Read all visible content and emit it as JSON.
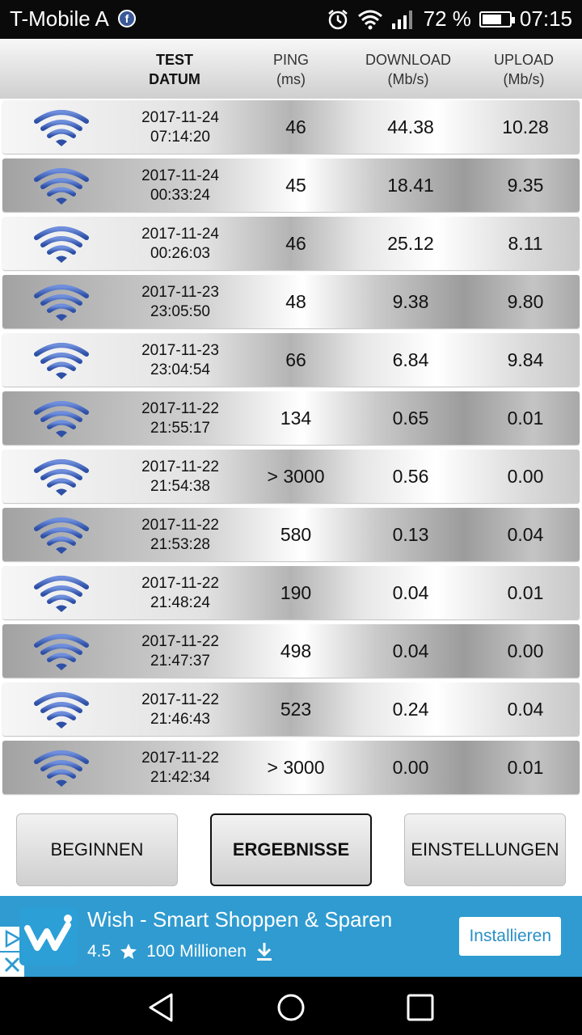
{
  "status_bar": {
    "carrier": "T-Mobile A",
    "battery_text": "72 %",
    "time": "07:15",
    "battery_level": 0.72
  },
  "header": {
    "col_test": "TEST",
    "col_datum": "DATUM",
    "col_ping": "PING",
    "col_ping_unit": "(ms)",
    "col_download": "DOWNLOAD",
    "col_download_unit": "(Mb/s)",
    "col_upload": "UPLOAD",
    "col_upload_unit": "(Mb/s)"
  },
  "rows": [
    {
      "date": "2017-11-24",
      "time": "07:14:20",
      "ping": "46",
      "download": "44.38",
      "upload": "10.28"
    },
    {
      "date": "2017-11-24",
      "time": "00:33:24",
      "ping": "45",
      "download": "18.41",
      "upload": "9.35"
    },
    {
      "date": "2017-11-24",
      "time": "00:26:03",
      "ping": "46",
      "download": "25.12",
      "upload": "8.11"
    },
    {
      "date": "2017-11-23",
      "time": "23:05:50",
      "ping": "48",
      "download": "9.38",
      "upload": "9.80"
    },
    {
      "date": "2017-11-23",
      "time": "23:04:54",
      "ping": "66",
      "download": "6.84",
      "upload": "9.84"
    },
    {
      "date": "2017-11-22",
      "time": "21:55:17",
      "ping": "134",
      "download": "0.65",
      "upload": "0.01"
    },
    {
      "date": "2017-11-22",
      "time": "21:54:38",
      "ping": "> 3000",
      "download": "0.56",
      "upload": "0.00"
    },
    {
      "date": "2017-11-22",
      "time": "21:53:28",
      "ping": "580",
      "download": "0.13",
      "upload": "0.04"
    },
    {
      "date": "2017-11-22",
      "time": "21:48:24",
      "ping": "190",
      "download": "0.04",
      "upload": "0.01"
    },
    {
      "date": "2017-11-22",
      "time": "21:47:37",
      "ping": "498",
      "download": "0.04",
      "upload": "0.00"
    },
    {
      "date": "2017-11-22",
      "time": "21:46:43",
      "ping": "523",
      "download": "0.24",
      "upload": "0.04"
    },
    {
      "date": "2017-11-22",
      "time": "21:42:34",
      "ping": "> 3000",
      "download": "0.00",
      "upload": "0.01"
    }
  ],
  "buttons": {
    "start": "BEGINNEN",
    "results": "ERGEBNISSE",
    "settings": "EINSTELLUNGEN"
  },
  "ad": {
    "title": "Wish - Smart Shoppen & Sparen",
    "rating": "4.5",
    "installs": "100 Millionen",
    "install_label": "Installieren"
  },
  "colors": {
    "ad_background": "#2f9bd0",
    "wifi_icon": "#3a5fb5",
    "status_bar": "#0a0a0a"
  },
  "icons": {
    "row_icon": "wifi-icon",
    "status": [
      "facebook-icon",
      "alarm-icon",
      "wifi-icon",
      "signal-icon",
      "battery-icon"
    ],
    "ad": [
      "wish-logo-icon",
      "star-icon",
      "download-icon",
      "adchoices-icon",
      "close-icon"
    ],
    "nav": [
      "back-icon",
      "home-icon",
      "recents-icon"
    ]
  }
}
